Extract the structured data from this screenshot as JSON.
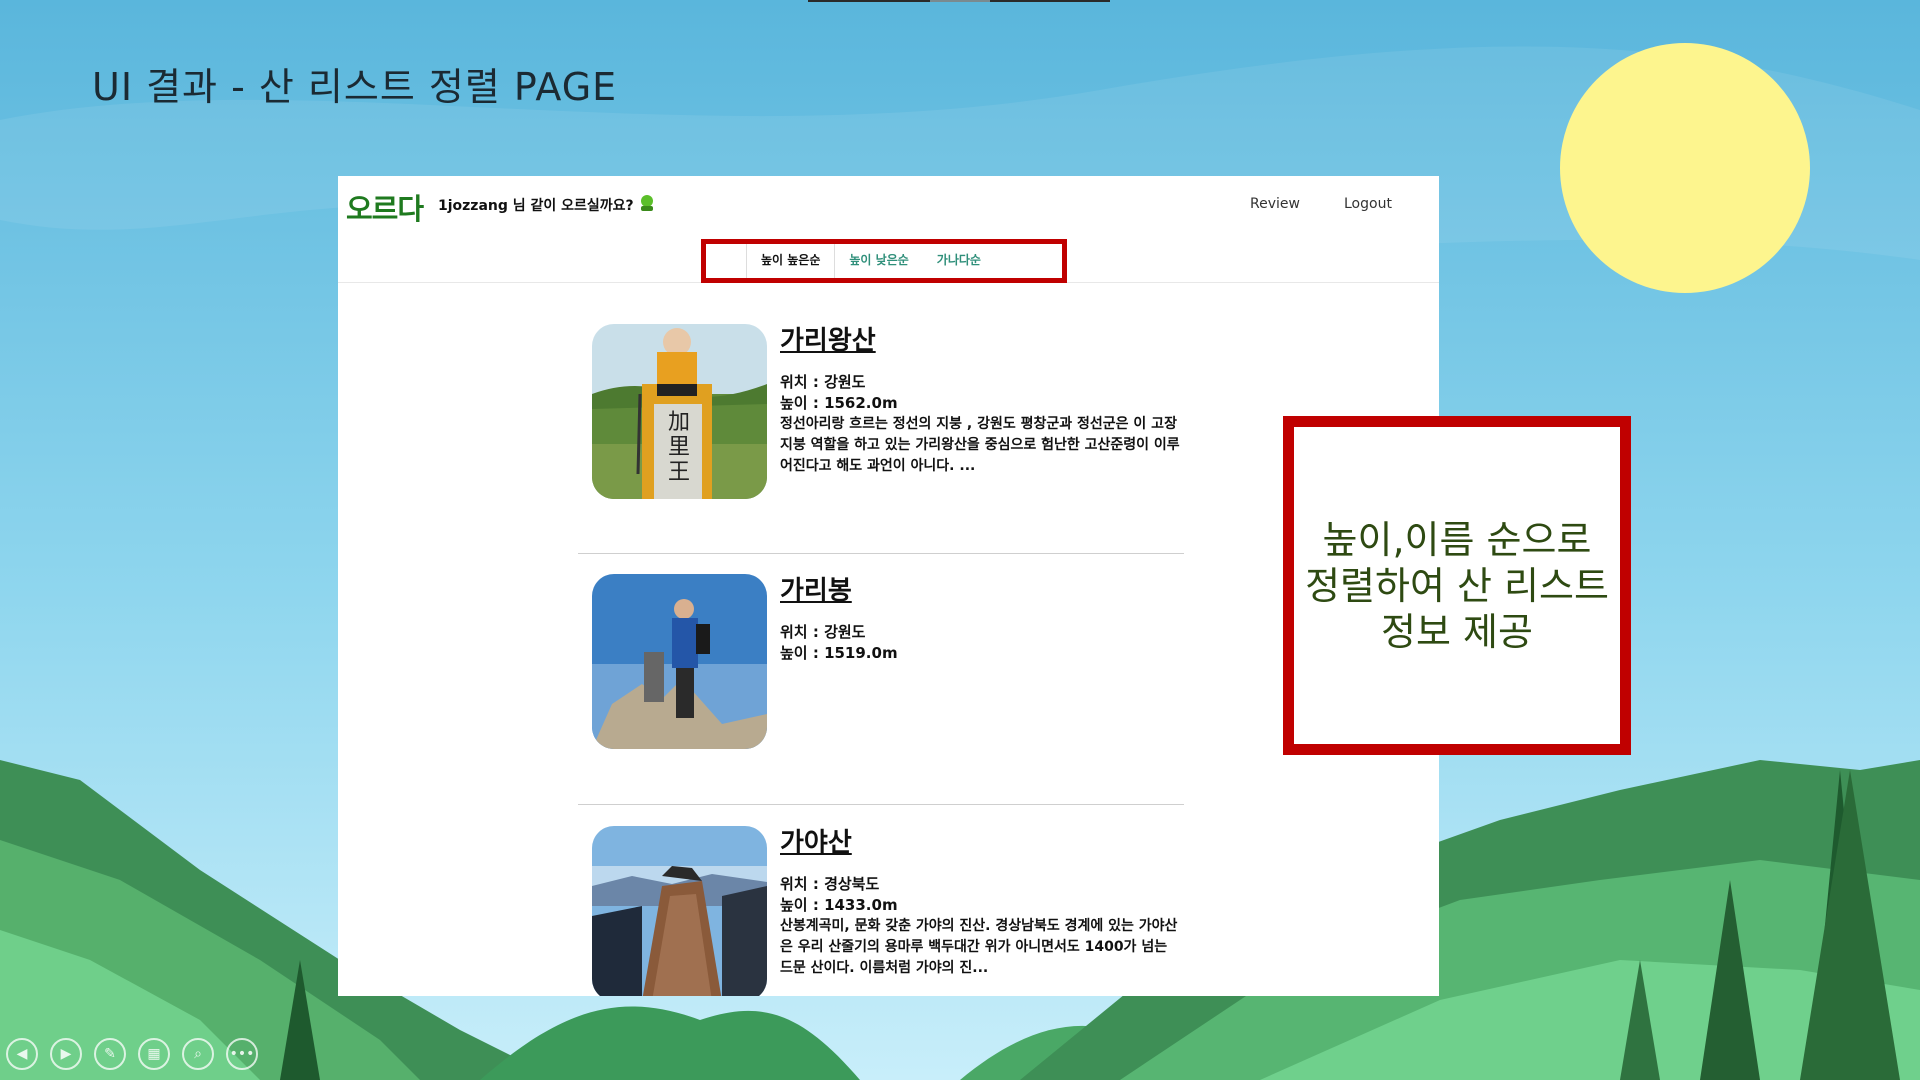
{
  "slide": {
    "title": "UI 결과 -  산 리스트 정렬 PAGE",
    "callout": [
      "높이,이름 순으로",
      "정렬하여 산 리스트",
      "정보 제공"
    ],
    "colors": {
      "sky_top": "#5db8de",
      "sky_bottom": "#c8eefa",
      "sun": "#fdf58e",
      "highlight_red": "#c00000",
      "mountain_green": "#3e8f56"
    }
  },
  "webpage": {
    "logo": "오르다",
    "greeting": "1jozzang 님 같이 오르실까요?",
    "greeting_icon": "mountain-icon",
    "nav": {
      "review": "Review",
      "logout": "Logout"
    },
    "sort_options": [
      {
        "label": "높이 높은순",
        "active": true
      },
      {
        "label": "높이 낮은순",
        "active": false
      },
      {
        "label": "가나다순",
        "active": false
      }
    ],
    "location_label": "위치",
    "height_label": "높이",
    "mountains": [
      {
        "name": "가리왕산",
        "location": "강원도",
        "height": "1562.0m",
        "description": "정선아리랑 흐르는 정선의 지붕 , 강원도 평창군과 정선군은 이 고장 지붕 역할을 하고 있는 가리왕산을 중심으로 험난한 고산준령이 이루어진다고 해도 과언이 아니다. ..."
      },
      {
        "name": "가리봉",
        "location": "강원도",
        "height": "1519.0m",
        "description": ""
      },
      {
        "name": "가야산",
        "location": "경상북도",
        "height": "1433.0m",
        "description": "산봉계곡미, 문화 갖춘 가야의 진산. 경상남북도 경계에 있는 가야산은 우리 산줄기의 용마루 백두대간 위가 아니면서도 1400가 넘는 드문 산이다. 이름처럼 가야의 진..."
      }
    ]
  },
  "presenter_controls": [
    "previous-icon",
    "next-icon",
    "pen-icon",
    "slides-grid-icon",
    "zoom-icon",
    "more-icon"
  ]
}
